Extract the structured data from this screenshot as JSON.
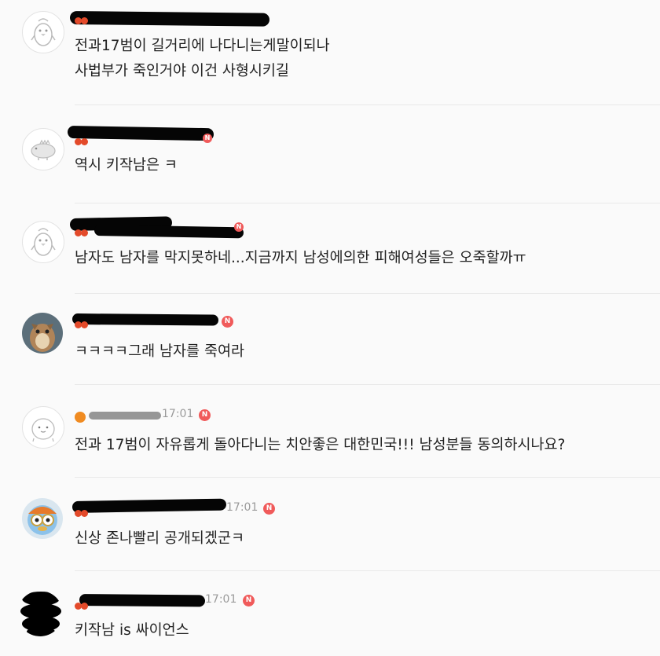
{
  "comments": [
    {
      "time": "",
      "lines": [
        "전과17범이 길거리에 나다니는게말이되나",
        "사법부가 죽인거야 이건 사형시키길"
      ],
      "avatar": "penguin-icon"
    },
    {
      "time": "",
      "lines": [
        "역시 키작남은 ㅋ"
      ],
      "avatar": "dinosaur-icon"
    },
    {
      "time": "",
      "lines": [
        "남자도 남자를 막지못하네...지금까지 남성에의한 피해여성들은 오죽할까ㅠ"
      ],
      "avatar": "penguin-icon"
    },
    {
      "time": "",
      "lines": [
        "ㅋㅋㅋㅋ그래 남자를 죽여라"
      ],
      "avatar": "squirrel-photo"
    },
    {
      "time": "17:01",
      "lines": [
        "전과 17범이 자유롭게 돌아다니는 치안좋은 대한민국!!! 남성분들 동의하시나요?"
      ],
      "avatar": "blob-icon"
    },
    {
      "time": "17:01",
      "lines": [
        "신상 존나빨리 공개되겠군ㅋ"
      ],
      "avatar": "pororo-photo"
    },
    {
      "time": "17:01",
      "lines": [
        "키작남 is 싸이언스"
      ],
      "avatar": "redacted-avatar"
    }
  ],
  "badge_label": "N",
  "colors": {
    "badge": "#f05a5a",
    "fruit": "#e34a2a",
    "timestamp": "#9a9a9a",
    "divider": "#e9e9e9"
  }
}
